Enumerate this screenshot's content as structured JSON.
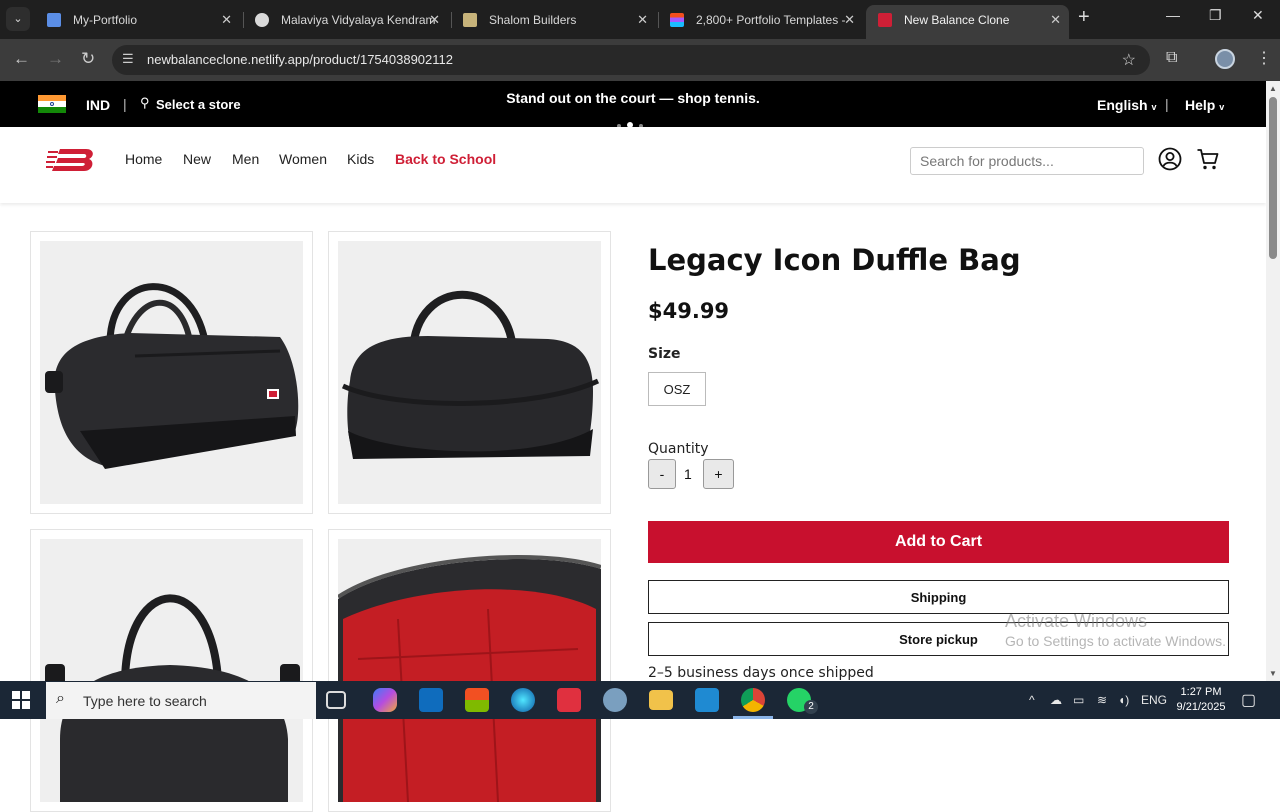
{
  "browser": {
    "tabs": [
      {
        "title": "My-Portfolio",
        "favicon_color": "#5b8ee6"
      },
      {
        "title": "Malaviya Vidyalaya Kendram",
        "favicon_color": "#d9d9d9"
      },
      {
        "title": "Shalom Builders",
        "favicon_color": "#c7b37a"
      },
      {
        "title": "2,800+ Portfolio Templates -",
        "favicon_color": "#f24e1e"
      },
      {
        "title": "New Balance Clone",
        "favicon_color": "#cf1f36"
      }
    ],
    "active_tab_index": 4,
    "url": "newbalanceclone.netlify.app/product/1754038902112"
  },
  "promo": {
    "country": "IND",
    "store_link": "Select a store",
    "message": "Stand out on the court — shop tennis.",
    "language": "English",
    "help": "Help"
  },
  "nav": {
    "links": [
      "Home",
      "New",
      "Men",
      "Women",
      "Kids"
    ],
    "highlight_link": "Back to School",
    "search_placeholder": "Search for products..."
  },
  "product": {
    "title": "Legacy Icon Duffle Bag",
    "price": "$49.99",
    "size_label": "Size",
    "sizes": [
      "OSZ"
    ],
    "quantity_label": "Quantity",
    "quantity_value": "1",
    "decrement_label": "-",
    "increment_label": "+",
    "add_to_cart": "Add to Cart",
    "shipping_option": "Shipping",
    "pickup_option": "Store pickup",
    "shipping_note": "2–5 business days once shipped"
  },
  "watermark": {
    "line1": "Activate Windows",
    "line2": "Go to Settings to activate Windows."
  },
  "taskbar": {
    "search_placeholder": "Type here to search",
    "whatsapp_badge": "2",
    "language": "ENG",
    "time": "1:27 PM",
    "date": "9/21/2025"
  },
  "colors": {
    "brand_red": "#cf1f36",
    "cart_red": "#c8102e",
    "promo_bg": "#000000",
    "chrome_dark": "#1f1f1f"
  }
}
